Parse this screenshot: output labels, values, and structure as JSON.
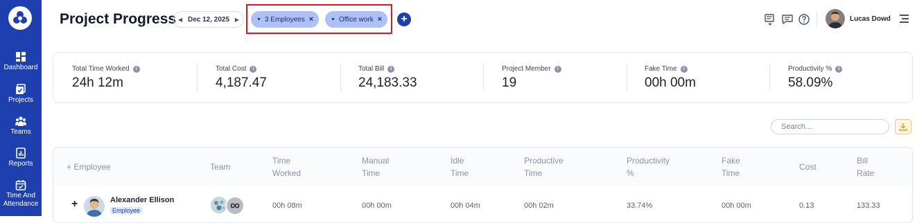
{
  "sidebar": {
    "items": [
      {
        "label": "Dashboard",
        "icon": "dashboard-icon"
      },
      {
        "label": "Projects",
        "icon": "projects-icon"
      },
      {
        "label": "Teams",
        "icon": "teams-icon"
      },
      {
        "label": "Reports",
        "icon": "reports-icon"
      },
      {
        "label": "Time And Attendance",
        "icon": "calendar-check-icon"
      }
    ]
  },
  "header": {
    "title": "Project Progress",
    "date": "Dec 12, 2025",
    "filters": [
      {
        "label": "3 Employees"
      },
      {
        "label": "Office work"
      }
    ],
    "user_name": "Lucas Dowd"
  },
  "stats": [
    {
      "label": "Total Time Worked",
      "value": "24h 12m"
    },
    {
      "label": "Total Cost",
      "value": "4,187.47"
    },
    {
      "label": "Total Bill",
      "value": "24,183.33"
    },
    {
      "label": "Project Member",
      "value": "19"
    },
    {
      "label": "Fake Time",
      "value": "00h 00m"
    },
    {
      "label": "Productivity %",
      "value": "58.09%"
    }
  ],
  "search": {
    "placeholder": "Search..."
  },
  "table": {
    "columns": [
      {
        "line1": "+ Employee",
        "line2": ""
      },
      {
        "line1": "Team",
        "line2": ""
      },
      {
        "line1": "Time",
        "line2": "Worked"
      },
      {
        "line1": "Manual",
        "line2": "Time"
      },
      {
        "line1": "Idle",
        "line2": "Time"
      },
      {
        "line1": "Productive",
        "line2": "Time"
      },
      {
        "line1": "Productivity",
        "line2": "%"
      },
      {
        "line1": "Fake",
        "line2": "Time"
      },
      {
        "line1": "Cost",
        "line2": ""
      },
      {
        "line1": "Bill",
        "line2": "Rate"
      }
    ],
    "rows": [
      {
        "expand": "+",
        "name": "Alexander Ellison",
        "role": "Employee",
        "time_worked": "00h 08m",
        "manual_time": "00h 00m",
        "idle_time": "00h 04m",
        "productive_time": "00h 02m",
        "productivity": "33.74%",
        "fake_time": "00h 00m",
        "cost": "0.13",
        "bill_rate": "133.33"
      }
    ]
  },
  "colors": {
    "sidebar": "#1e3fae",
    "chip": "#aec0f5",
    "highlight_box": "#e0141e"
  }
}
